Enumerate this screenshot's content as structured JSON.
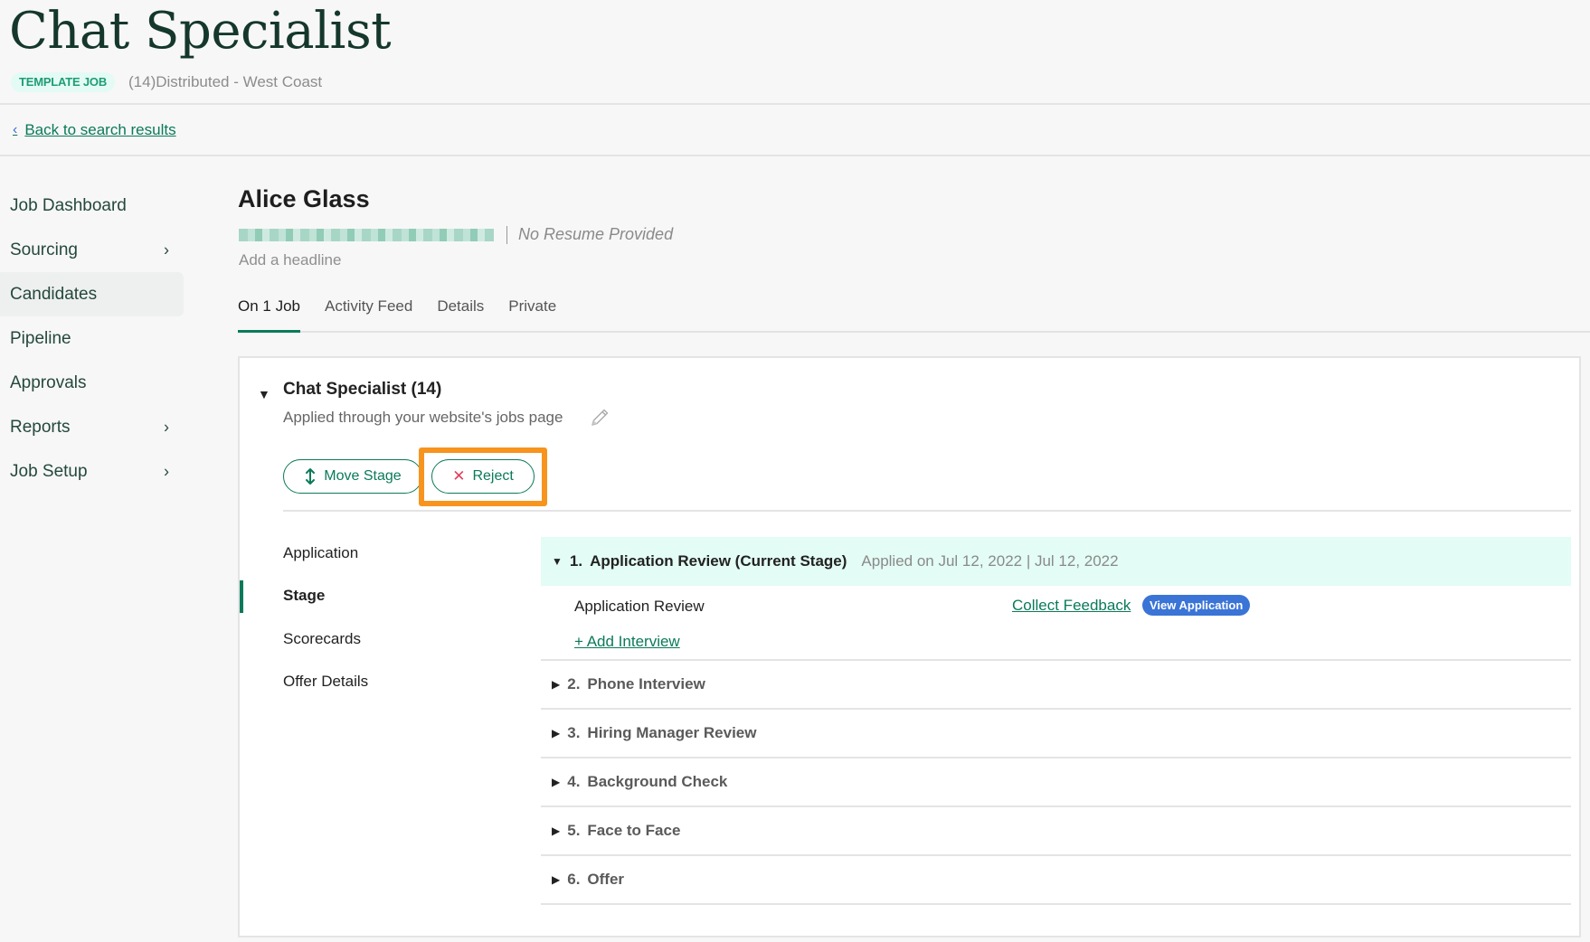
{
  "header": {
    "title": "Chat Specialist",
    "badge": "TEMPLATE JOB",
    "location": "(14)Distributed - West Coast",
    "back_link": "Back to search results"
  },
  "sidebar": {
    "items": [
      {
        "label": "Job Dashboard",
        "has_arrow": false,
        "active": false
      },
      {
        "label": "Sourcing",
        "has_arrow": true,
        "active": false
      },
      {
        "label": "Candidates",
        "has_arrow": false,
        "active": true
      },
      {
        "label": "Pipeline",
        "has_arrow": false,
        "active": false
      },
      {
        "label": "Approvals",
        "has_arrow": false,
        "active": false
      },
      {
        "label": "Reports",
        "has_arrow": true,
        "active": false
      },
      {
        "label": "Job Setup",
        "has_arrow": true,
        "active": false
      }
    ],
    "arrow_glyph": "›"
  },
  "candidate": {
    "name": "Alice Glass",
    "email_redacted": true,
    "resume_status": "No Resume Provided",
    "headline_placeholder": "Add a headline"
  },
  "tabs": [
    {
      "label": "On 1 Job",
      "active": true
    },
    {
      "label": "Activity Feed",
      "active": false
    },
    {
      "label": "Details",
      "active": false
    },
    {
      "label": "Private",
      "active": false
    }
  ],
  "job_card": {
    "title": "Chat Specialist (14)",
    "source": "Applied through your website's jobs page",
    "buttons": {
      "move_stage": "Move Stage",
      "reject": "Reject"
    },
    "subnav": [
      {
        "label": "Application",
        "active": false
      },
      {
        "label": "Stage",
        "active": true
      },
      {
        "label": "Scorecards",
        "active": false
      },
      {
        "label": "Offer Details",
        "active": false
      }
    ],
    "current_stage": {
      "number": "1.",
      "title": "Application Review (Current Stage)",
      "dates": "Applied on Jul 12, 2022 | Jul 12, 2022",
      "interview": "Application Review",
      "collect_feedback": "Collect Feedback",
      "view_application": "View Application",
      "add_interview": "+ Add Interview"
    },
    "stages": [
      {
        "number": "2.",
        "title": "Phone Interview"
      },
      {
        "number": "3.",
        "title": "Hiring Manager Review"
      },
      {
        "number": "4.",
        "title": "Background Check"
      },
      {
        "number": "5.",
        "title": "Face to Face"
      },
      {
        "number": "6.",
        "title": "Offer"
      }
    ]
  },
  "colors": {
    "brand_green": "#0b7a5a",
    "title_dark_green": "#15372c",
    "badge_bg": "#e3fbf4",
    "current_stage_bg": "#e3fcf5",
    "view_app_blue": "#3a74d6",
    "reject_red": "#e0405e",
    "highlight_orange": "#f7941d"
  }
}
